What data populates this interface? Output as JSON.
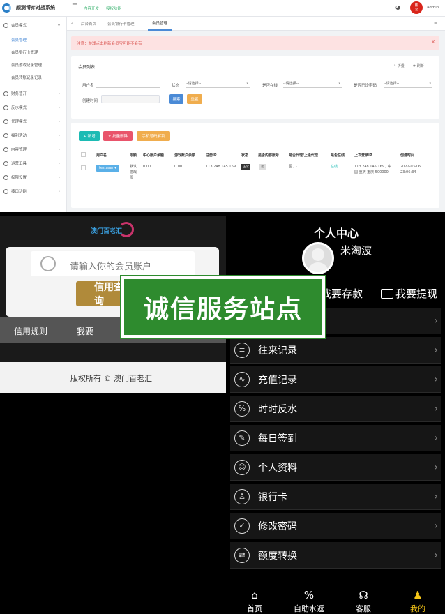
{
  "admin": {
    "system_title": "颜测博弈对战系统",
    "top_links": [
      "内容开发",
      "授权功能"
    ],
    "user": "admin",
    "avatar_text": "韩\n滢",
    "sidebar": {
      "items": [
        "会员模式",
        "财务营开",
        "反水模式",
        "代理模式",
        "福利活动",
        "内容管理",
        "运营工具",
        "权限设置",
        "接口功能"
      ],
      "subitems": [
        "会员管理",
        "会员银行卡管理",
        "会员游戏记录管理",
        "会员转账记录记录"
      ]
    },
    "tabs": [
      "后台首页",
      "会员银行卡管理",
      "会员管理"
    ],
    "notice": "注意：游戏点击刷新会员宝可能不会有",
    "panel_title": "会员列表",
    "panel_actions": [
      "折叠",
      "刷新"
    ],
    "filters": {
      "username_label": "用户名",
      "status_label": "状态",
      "status_value": "--请选择--",
      "online_label": "是否在线",
      "online_value": "--请选择--",
      "password_label": "是否已设密码",
      "password_value": "--请选择--",
      "time_label": "创建时间",
      "search_btn": "搜索",
      "reset_btn": "重置"
    },
    "toolbar": {
      "add": "+ 新增",
      "batch_delete": "× 批量删除",
      "unlock": "手机号码解锁"
    },
    "table": {
      "headers": [
        "用户名",
        "限额",
        "中心账户余额",
        "游戏账户余额",
        "注册IP",
        "状态",
        "是否内部账号",
        "是否代理/上级代理",
        "是否在线",
        "上次登录IP",
        "创建时间"
      ],
      "row": {
        "username": "testuser",
        "limit": "默认\n游戏\n限",
        "center_balance": "0.00",
        "game_balance": "0.00",
        "reg_ip": "113.248.145.169",
        "status": "正常",
        "internal": "否",
        "agent": "否 / -",
        "online": "在线",
        "last_ip": "113.248.145.169 / 中\n国 重庆 重庆 500000",
        "created": "2022-03-06\n23:06:34"
      }
    }
  },
  "login_page": {
    "logo_text": "澳门百老汇",
    "placeholder": "请输入你的会员账户",
    "query_btn": "信用查询",
    "nav": [
      "信用规则",
      "我要"
    ],
    "copyright": "版权所有 © 澳门百老汇"
  },
  "user_center": {
    "title": "个人中心",
    "username": "米淘波",
    "actions": [
      "我要存款",
      "我要提现"
    ],
    "menu": [
      {
        "label": "往来记录",
        "icon": "record-icon"
      },
      {
        "label": "充值记录",
        "icon": "recharge-icon"
      },
      {
        "label": "时时反水",
        "icon": "percent-icon"
      },
      {
        "label": "每日签到",
        "icon": "signin-icon"
      },
      {
        "label": "个人资料",
        "icon": "profile-icon"
      },
      {
        "label": "银行卡",
        "icon": "bankcard-icon"
      },
      {
        "label": "修改密码",
        "icon": "shield-icon"
      },
      {
        "label": "额度转换",
        "icon": "transfer-icon"
      }
    ],
    "bottom_nav": [
      "首页",
      "自助水返",
      "客服",
      "我的"
    ]
  },
  "banner": {
    "text": "诚信服务站点"
  },
  "colors": {
    "accent_gold": "#f5c518",
    "banner_green": "#2e8b2e",
    "admin_blue": "#4a8ad6",
    "query_gold": "#b08a3a"
  }
}
